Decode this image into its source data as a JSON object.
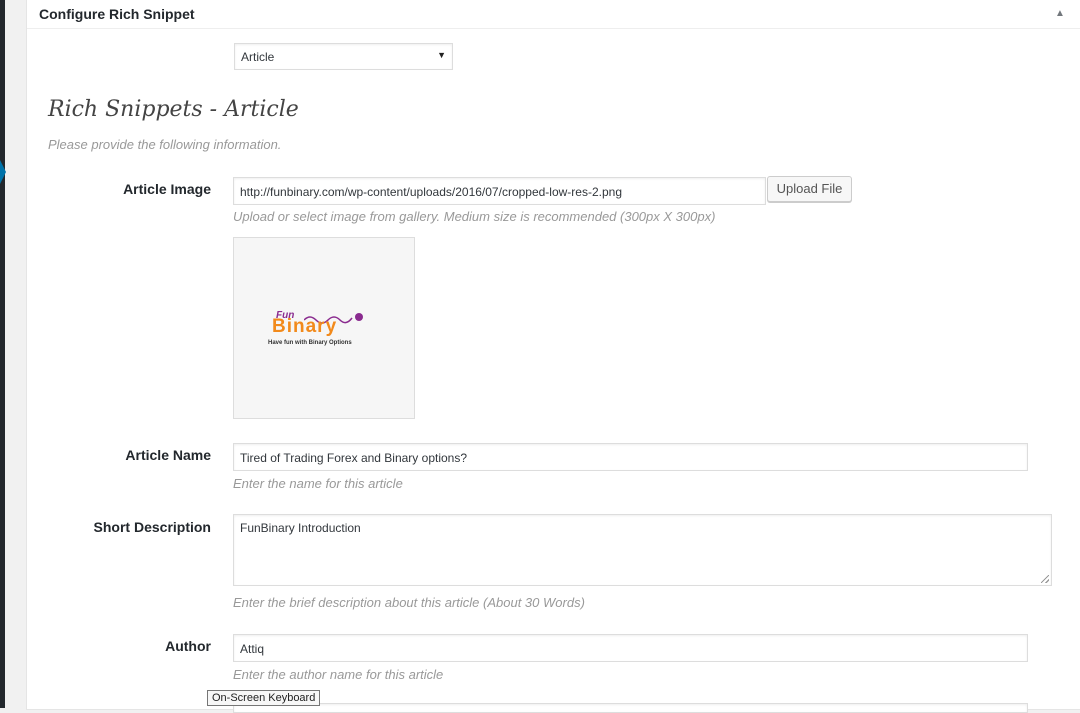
{
  "metabox": {
    "title": "Configure Rich Snippet",
    "toggle_icon": "arrow-up-icon"
  },
  "snippet_type": {
    "selected": "Article"
  },
  "section": {
    "heading": "Rich Snippets - Article",
    "subheading": "Please provide the following information."
  },
  "fields": {
    "article_image": {
      "label": "Article Image",
      "value": "http://funbinary.com/wp-content/uploads/2016/07/cropped-low-res-2.png",
      "button_label": "Upload File",
      "hint": "Upload or select image from gallery. Medium size is recommended (300px X 300px)"
    },
    "article_name": {
      "label": "Article Name",
      "value": "Tired of Trading Forex and Binary options?",
      "hint": "Enter the name for this article"
    },
    "short_description": {
      "label": "Short Description",
      "value": "FunBinary Introduction",
      "hint": "Enter the brief description about this article (About 30 Words)"
    },
    "author": {
      "label": "Author",
      "value": "Attiq",
      "hint": "Enter the author name for this article"
    }
  },
  "logo": {
    "fun": "Fun",
    "binary": "Binary",
    "tagline": "Have fun with Binary Options"
  },
  "tooltip": {
    "text": "On-Screen Keyboard"
  },
  "colors": {
    "admin_bar": "#23282d",
    "accent": "#0073aa",
    "logo_orange": "#f28a1b",
    "logo_purple": "#8a2b8f"
  }
}
